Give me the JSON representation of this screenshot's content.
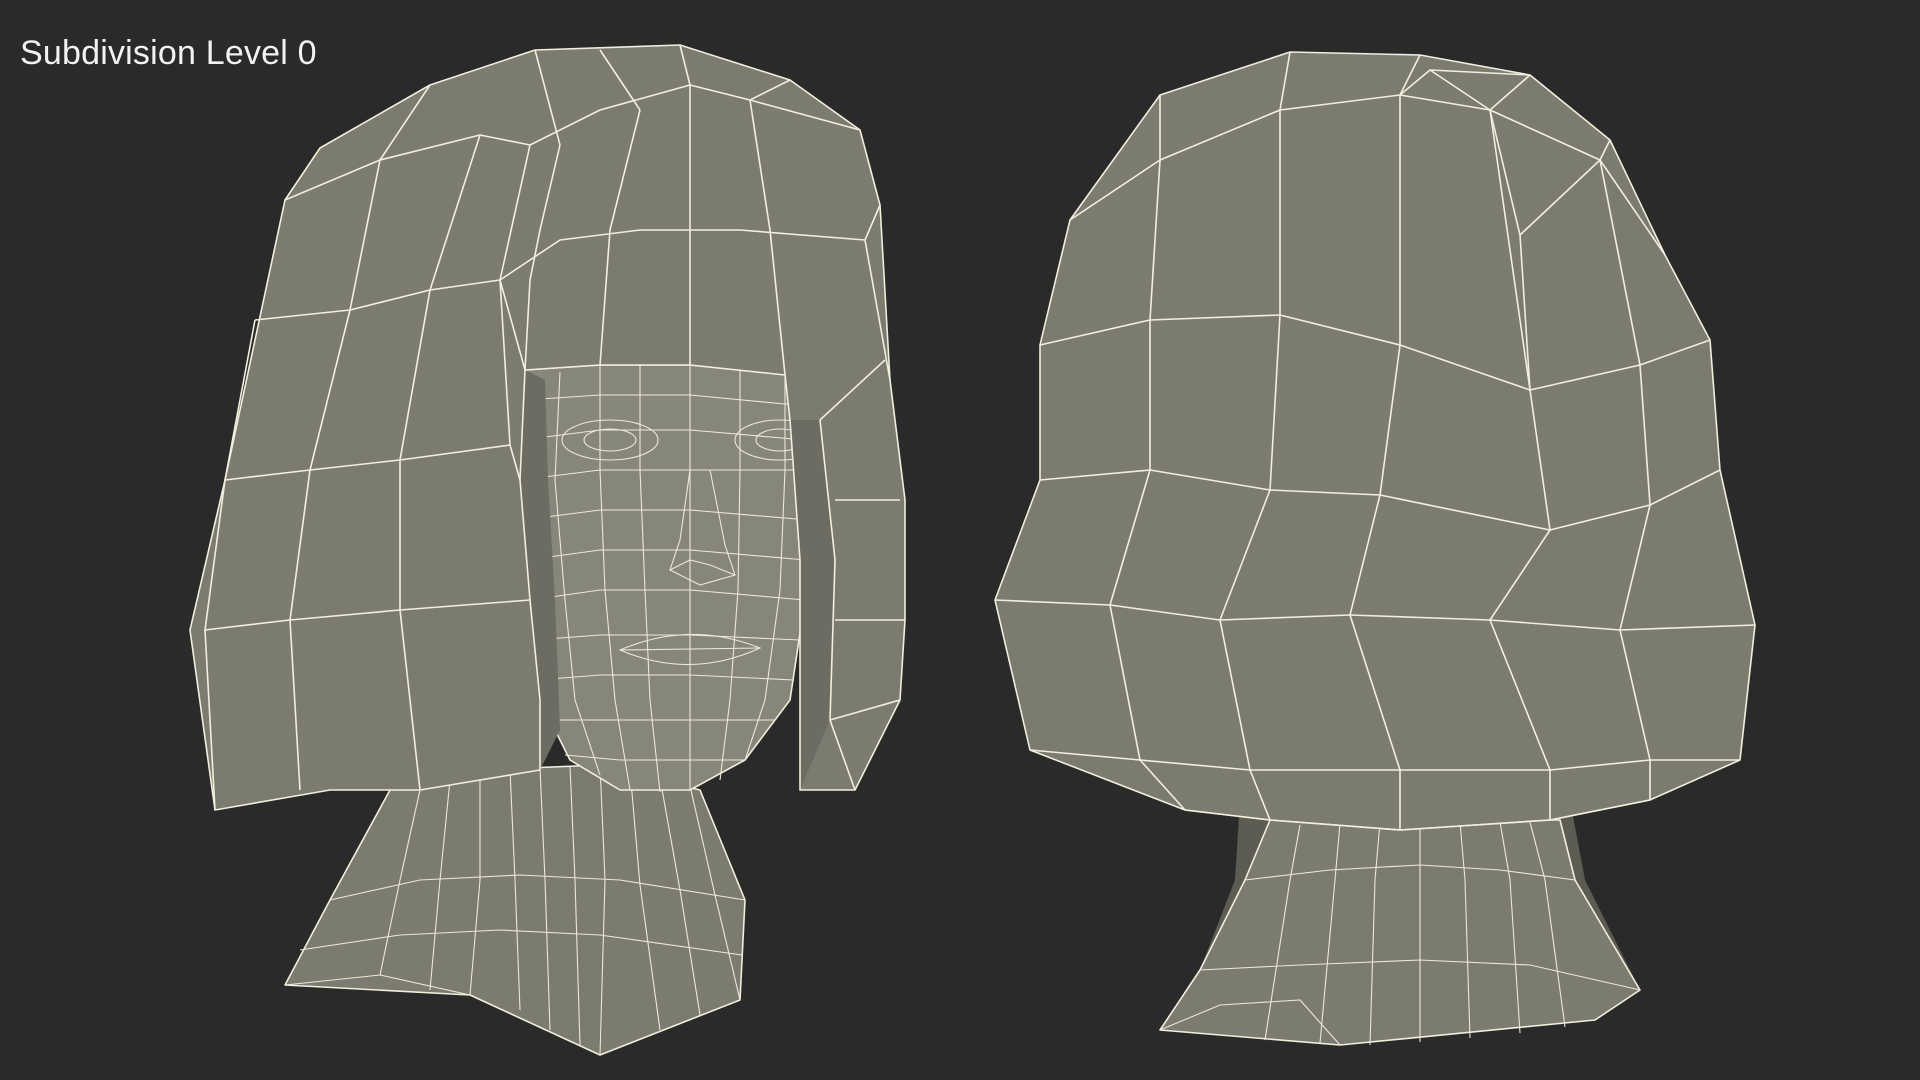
{
  "caption": {
    "text": "Subdivision Level 0"
  },
  "colors": {
    "background": "#2a2a2a",
    "surface": "#7b7b70",
    "wireframe": "#f1eedc",
    "caption_text": "#f2f2f2"
  },
  "views": [
    {
      "icon": "front-view-head-mesh-icon"
    },
    {
      "icon": "back-view-head-mesh-icon"
    }
  ]
}
